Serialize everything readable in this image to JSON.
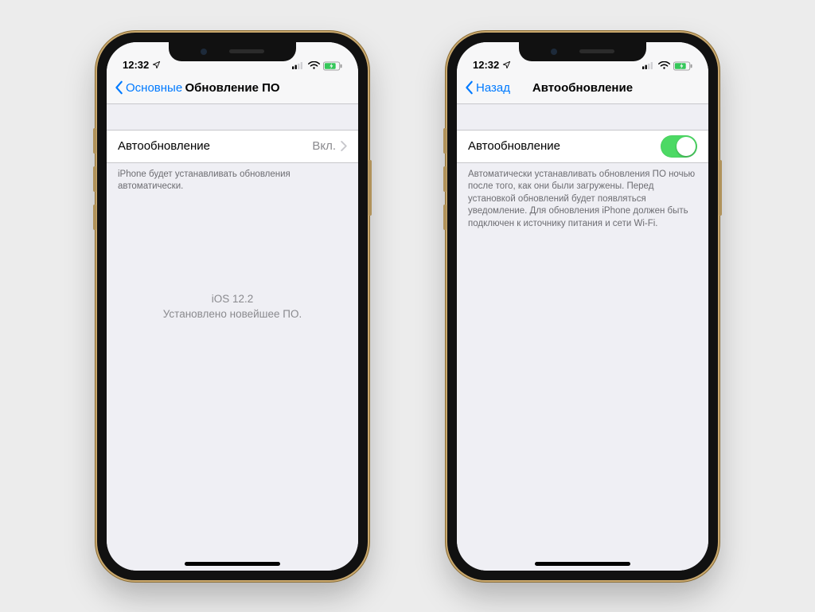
{
  "status": {
    "time": "12:32",
    "location_icon": "location-arrow",
    "signal_icon": "dual-sim-signal",
    "wifi_icon": "wifi",
    "battery_icon": "battery-charging"
  },
  "left_screen": {
    "nav": {
      "back_label": "Основные",
      "title": "Обновление ПО"
    },
    "row": {
      "label": "Автообновление",
      "value": "Вкл."
    },
    "footer_note": "iPhone будет устанавливать обновления автоматически.",
    "center": {
      "line1": "iOS 12.2",
      "line2": "Установлено новейшее ПО."
    }
  },
  "right_screen": {
    "nav": {
      "back_label": "Назад",
      "title": "Автообновление"
    },
    "row": {
      "label": "Автообновление",
      "toggle_on": true
    },
    "footer_note": "Автоматически устанавливать обновления ПО ночью после того, как они были загружены. Перед установкой обновлений будет появляться уведомление. Для обновления iPhone должен быть подключен к источнику питания и сети Wi-Fi."
  },
  "colors": {
    "ios_blue": "#007aff",
    "ios_green": "#4cd964",
    "group_bg": "#efeff4",
    "separator": "#c7c7cb",
    "secondary_text": "#8a8a8e"
  }
}
